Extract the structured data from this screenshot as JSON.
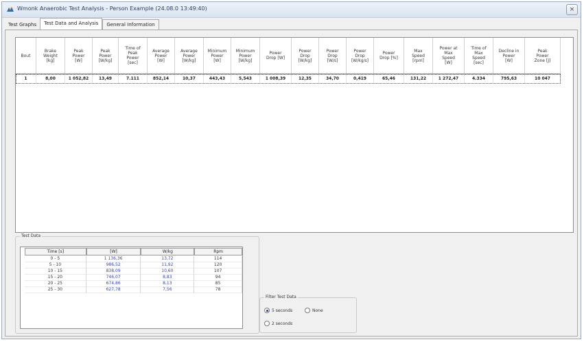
{
  "window": {
    "title": "Wmonk Anaerobic Test Analysis - Person Example (24.08.0 13:49:40)",
    "close_label": "×"
  },
  "tabs": [
    {
      "label": "Test Graphs",
      "state": "normal"
    },
    {
      "label": "Test Data and Analysis",
      "state": "active"
    },
    {
      "label": "General Information",
      "state": "outlined"
    }
  ],
  "results_table": {
    "columns": [
      "Bout",
      "Brake\nWeight\n[kg]",
      "Peak\nPower\n[W]",
      "Peak\nPower\n[W/kg]",
      "Time of\nPeak\nPower\n[sec]",
      "Average\nPower\n[W]",
      "Average\nPower\n[W/kg]",
      "Minimum\nPower\n[W]",
      "Minimum\nPower\n[W/kg]",
      "Power\nDrop [W]",
      "Power\nDrop\n[W/kg]",
      "Power\nDrop\n[W/s]",
      "Power\nDrop\n[W/kg/s]",
      "Power\nDrop [%]",
      "Max\nSpeed\n[rpm]",
      "Power at\nMax\nSpeed\n[W]",
      "Time of\nMax\nSpeed\n[sec]",
      "Decline in\nPower\n[W]",
      "Peak\nPower\nZone [J]"
    ],
    "rows": [
      [
        "1",
        "8,00",
        "1 052,82",
        "13,49",
        "7.111",
        "852,14",
        "10,37",
        "443,43",
        "5,543",
        "1 008,39",
        "12,35",
        "34,70",
        "0,419",
        "65,46",
        "131,22",
        "1 272,47",
        "4.334",
        "795,63",
        "10 047"
      ]
    ]
  },
  "test_data": {
    "label": "Test Data",
    "columns": [
      "Time [s]",
      "[W]",
      "W/kg",
      "Rpm"
    ],
    "rows": [
      [
        "0 - 5",
        "1 136,36",
        "13,72",
        "114"
      ],
      [
        "5 - 10",
        "986,52",
        "11,92",
        "120"
      ],
      [
        "10 - 15",
        "838,09",
        "10,60",
        "107"
      ],
      [
        "15 - 20",
        "746,07",
        "8,83",
        "94"
      ],
      [
        "20 - 25",
        "674,86",
        "8,13",
        "85"
      ],
      [
        "25 - 30",
        "627,78",
        "7,56",
        "78"
      ]
    ]
  },
  "filter": {
    "label": "Filter Test Data",
    "options": [
      {
        "label": "5 seconds",
        "checked": true
      },
      {
        "label": "None",
        "checked": false
      },
      {
        "label": "2 seconds",
        "checked": false
      }
    ]
  }
}
